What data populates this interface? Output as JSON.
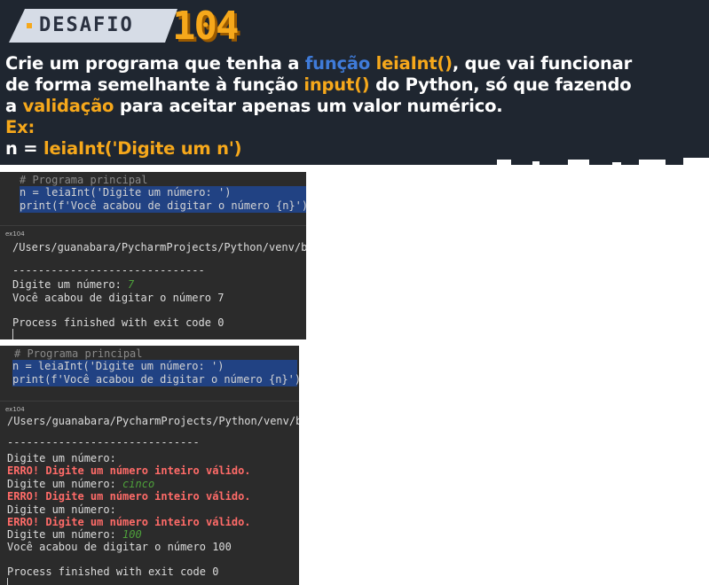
{
  "banner": {
    "tag": "DESAFIO",
    "number": "104",
    "lines": {
      "l1_a": "Crie um programa que tenha a ",
      "l1_b": "função",
      "l1_c": " ",
      "l1_d": "leiaInt()",
      "l1_e": ", que vai funcionar",
      "l2_a": "de forma semelhante à função ",
      "l2_b": "input()",
      "l2_c": " do Python, só que fazendo",
      "l3_a": "a ",
      "l3_b": "validação",
      "l3_c": " para aceitar apenas um valor numérico.",
      "l4": "Ex:",
      "l5_a": "n = ",
      "l5_b": "leiaInt('Digite um n')"
    },
    "colors": {
      "background": "#1f2630",
      "orange": "#f6a81b",
      "blue": "#3f7bd9"
    }
  },
  "panel1": {
    "editor": {
      "comment": "# Programa principal",
      "line1": "n = leiaInt('Digite um número: ')",
      "line2": "print(f'Você acabou de digitar o número {n}')"
    },
    "console": {
      "tab": "ex104",
      "path": "/Users/guanabara/PycharmProjects/Python/venv/bin",
      "separator": "------------------------------",
      "prompt": "Digite um número: ",
      "input": "7",
      "result": "Você acabou de digitar o número 7",
      "exit": "Process finished with exit code 0"
    }
  },
  "panel2": {
    "editor": {
      "comment": "# Programa principal",
      "line1": "n = leiaInt('Digite um número: ')",
      "line2": "print(f'Você acabou de digitar o número {n}')"
    },
    "console": {
      "tab": "ex104",
      "path": "/Users/guanabara/PycharmProjects/Python/venv/bin",
      "separator": "------------------------------",
      "prompt_empty": "Digite um número:",
      "error": "ERRO! Digite um número inteiro válido.",
      "prompt": "Digite um número: ",
      "input1": "cinco",
      "input2": "100",
      "result": "Você acabou de digitar o número 100",
      "exit": "Process finished with exit code 0"
    }
  }
}
